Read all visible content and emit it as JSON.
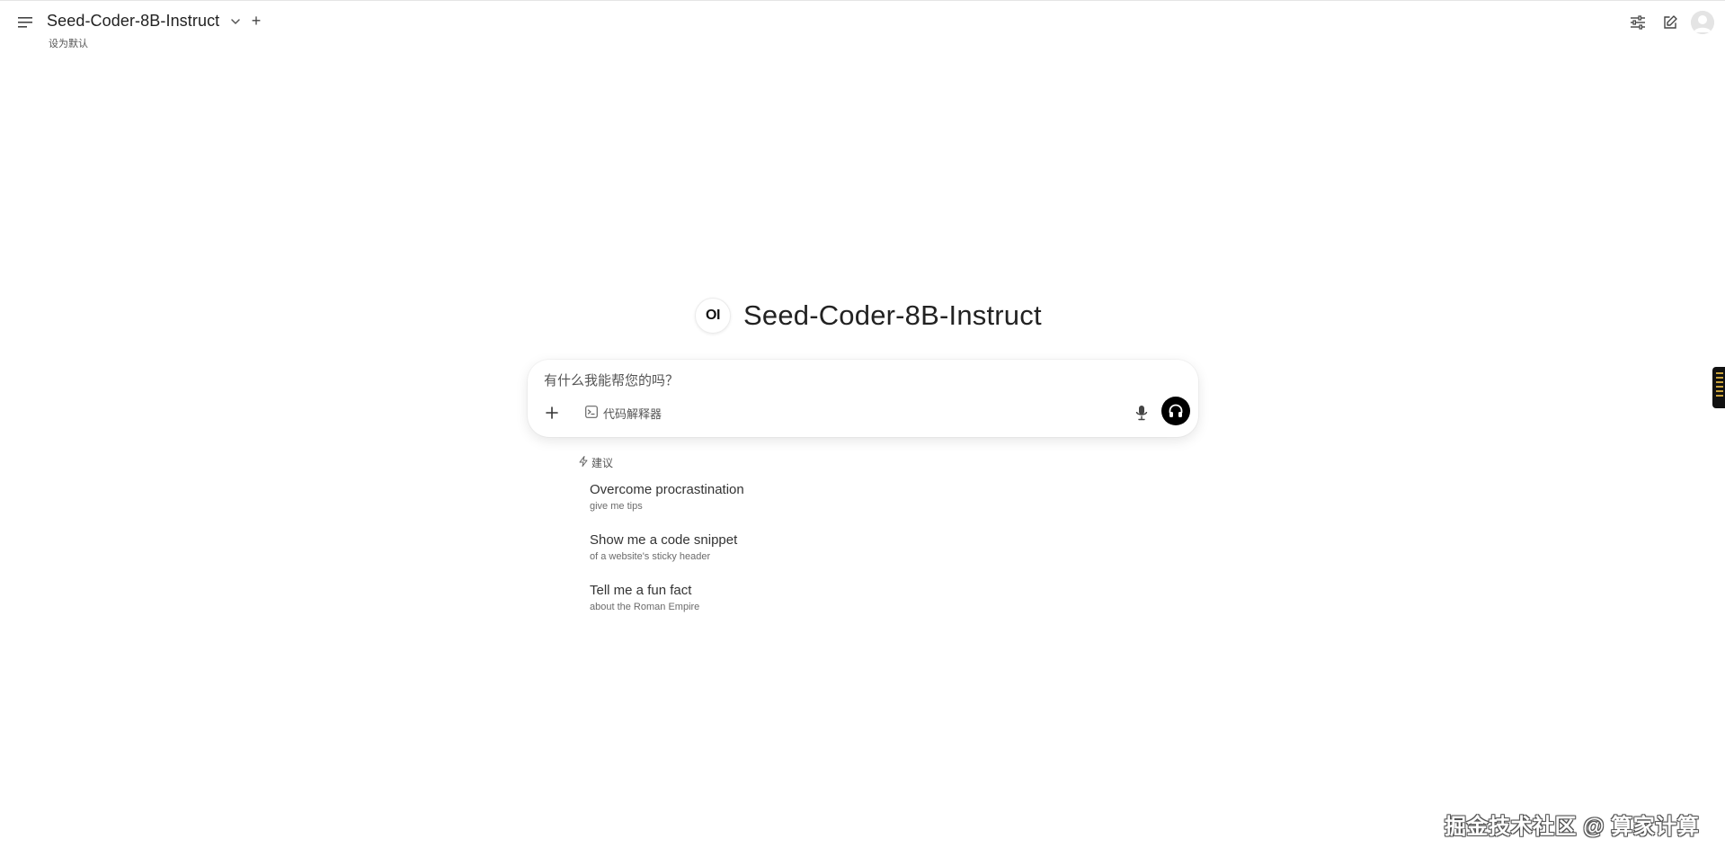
{
  "header": {
    "model_name": "Seed-Coder-8B-Instruct",
    "set_default": "设为默认",
    "add_model_symbol": "+",
    "icons": {
      "menu": "hamburger-menu-icon",
      "chevron": "chevron-down-icon",
      "controls": "sliders-icon",
      "new_chat": "edit-icon",
      "user": "user-avatar-icon"
    }
  },
  "hero": {
    "logo_text": "OI",
    "title": "Seed-Coder-8B-Instruct"
  },
  "composer": {
    "placeholder": "有什么我能帮您的吗？",
    "tool_label": "代码解释器",
    "icons": {
      "attach": "plus-icon",
      "tool": "code-terminal-icon",
      "mic": "microphone-icon",
      "call": "headphones-icon"
    },
    "accent": "#000000"
  },
  "suggestions": {
    "header": "建议",
    "header_icon": "lightning-icon",
    "items": [
      {
        "title": "Overcome procrastination",
        "subtitle": "give me tips"
      },
      {
        "title": "Show me a code snippet",
        "subtitle": "of a website's sticky header"
      },
      {
        "title": "Tell me a fun fact",
        "subtitle": "about the Roman Empire"
      }
    ]
  },
  "watermark": "掘金技术社区 @ 算家计算"
}
